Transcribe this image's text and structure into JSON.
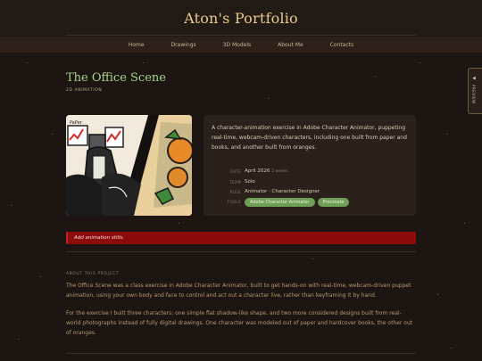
{
  "site": {
    "title": "Aton's Portfolio"
  },
  "nav": {
    "items": [
      "Home",
      "Drawings",
      "3D Models",
      "About Me",
      "Contacts"
    ]
  },
  "side_tab": {
    "label": "PREVIEW",
    "arrow": "◀"
  },
  "project": {
    "title": "The Office Scene",
    "category": "2D ANIMATION",
    "description": "A character-animation exercise in Adobe Character Animator, puppeting real-time, webcam-driven characters, including one built from paper and books, and another built from oranges.",
    "meta": {
      "date_label": "DATE",
      "date_value": "April 2026",
      "date_note": "2 weeks",
      "team_label": "TEAM",
      "team_value": "Solo",
      "role_label": "ROLE",
      "role_value": "Animator · Character Designer",
      "tools_label": "TOOLS",
      "tools": [
        "Adobe Character Animator",
        "Procreate"
      ]
    }
  },
  "alert": {
    "text": "Add animation stills."
  },
  "about": {
    "label": "ABOUT THIS PROJECT",
    "paragraphs": [
      "The Office Scene was a class exercise in Adobe Character Animator, built to get hands-on with real-time, webcam-driven puppet animation, using your own body and face to control and act out a character live, rather than keyframing it by hand.",
      "For the exercise I built three characters: one simple flat shadow-like shape, and two more considered designs built from real-world photographs instead of fully digital drawings. One character was modeled out of paper and hardcover books, the other out of oranges."
    ]
  },
  "colors": {
    "background": "#1c1511",
    "accent_title": "#e8c98b",
    "project_title": "#a9d48e",
    "tag": "#6f9f56",
    "alert": "#8c0b0b"
  }
}
